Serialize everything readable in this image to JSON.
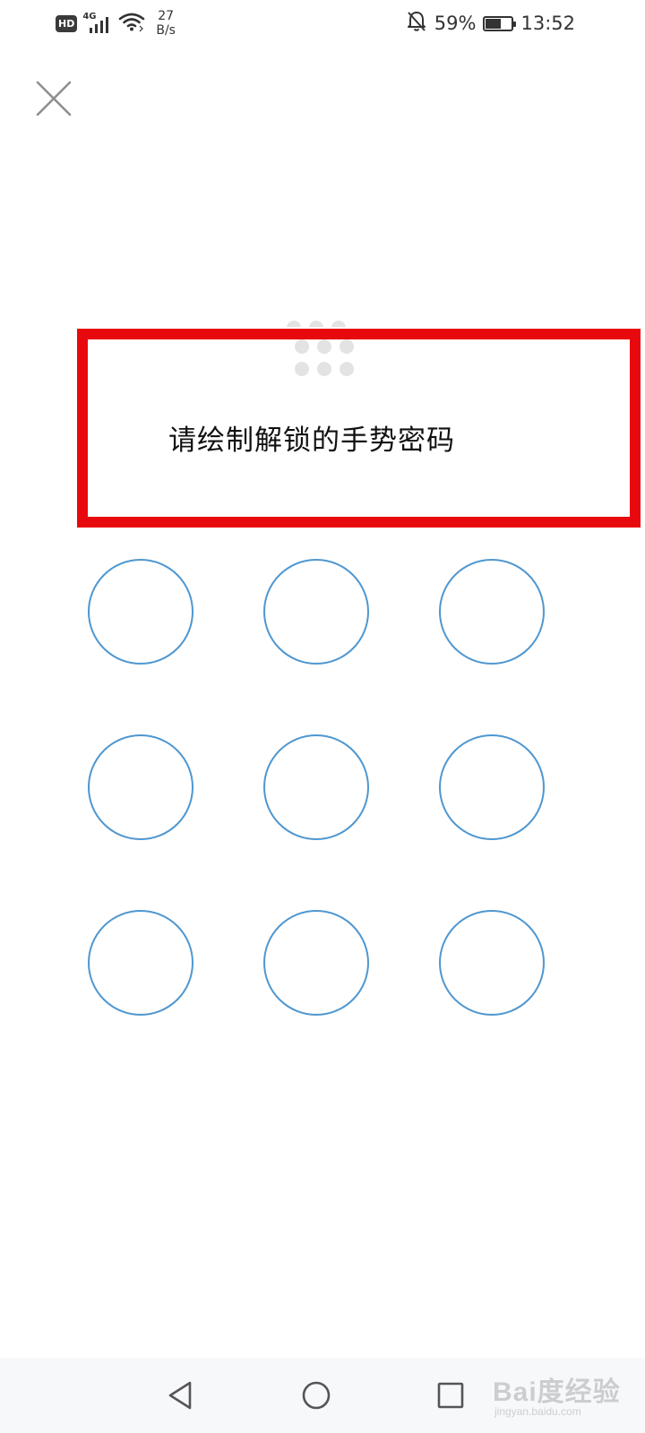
{
  "status_bar": {
    "hd_badge": "HD",
    "network_generation": "4G",
    "speed_value": "27",
    "speed_unit": "B/s",
    "battery_percent": "59%",
    "battery_level": 0.59,
    "time": "13:52",
    "icons": [
      "hd-icon",
      "signal-icon",
      "wifi-icon",
      "mute-bell-icon",
      "battery-icon"
    ]
  },
  "close_icon": "close-icon",
  "prompt": "请绘制解锁的手势密码",
  "pattern_preview_dots": 9,
  "gesture_grid": {
    "rows": 3,
    "cols": 3,
    "node_color": "#4f97d0"
  },
  "highlight_color": "#e8090e",
  "nav_bar": {
    "icons": [
      "back-triangle-icon",
      "home-circle-icon",
      "recents-square-icon"
    ]
  },
  "watermark": {
    "main": "Bai度经验",
    "sub": "jingyan.baidu.com"
  }
}
